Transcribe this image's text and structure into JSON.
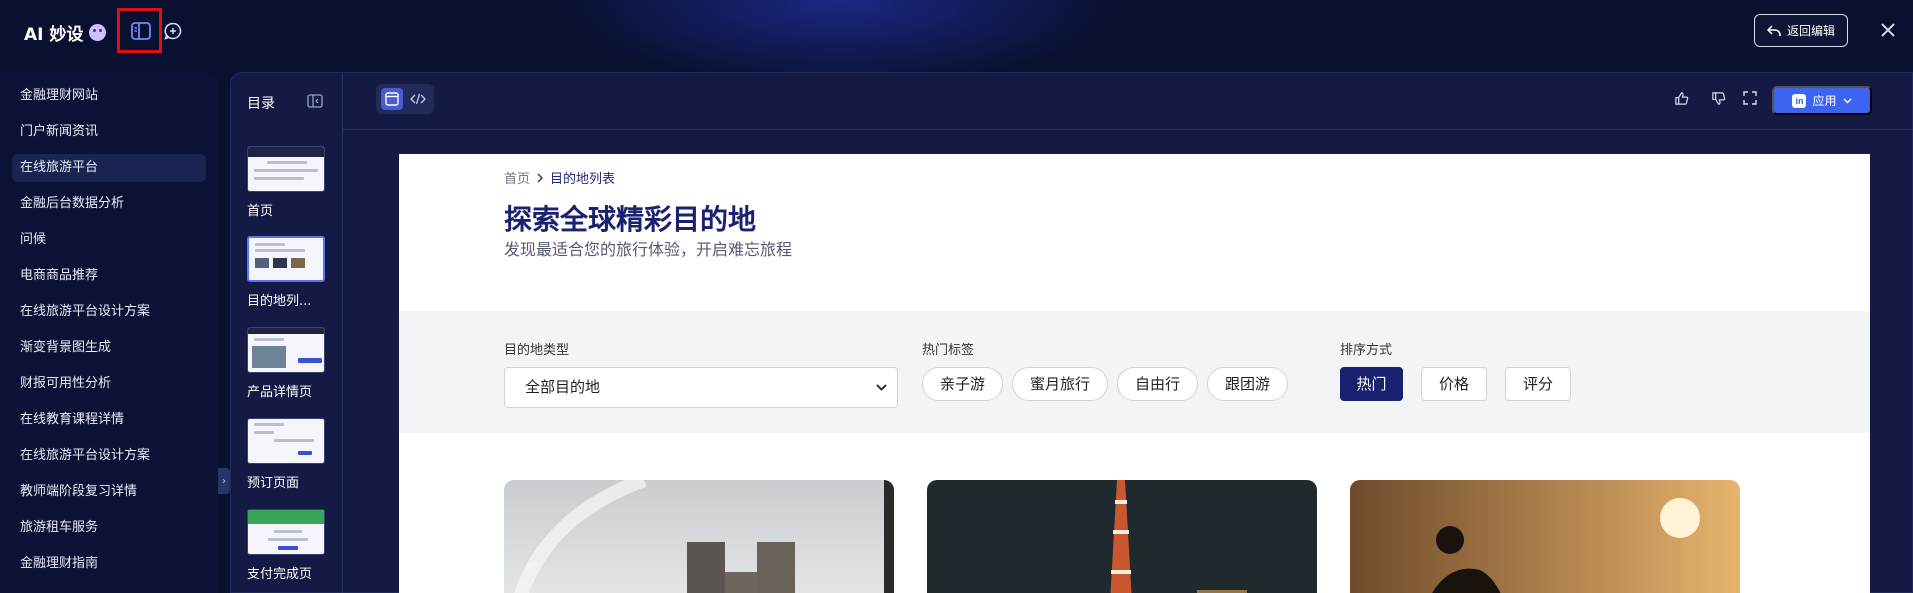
{
  "app": {
    "brand": "AI 妙设",
    "back_label": "返回编辑"
  },
  "sidebar": {
    "items": [
      {
        "label": "金融理财网站"
      },
      {
        "label": "门户新闻资讯"
      },
      {
        "label": "在线旅游平台"
      },
      {
        "label": "金融后台数据分析"
      },
      {
        "label": "问候"
      },
      {
        "label": "电商商品推荐"
      },
      {
        "label": "在线旅游平台设计方案"
      },
      {
        "label": "渐变背景图生成"
      },
      {
        "label": "财报可用性分析"
      },
      {
        "label": "在线教育课程详情"
      },
      {
        "label": "在线旅游平台设计方案"
      },
      {
        "label": "教师端阶段复习详情"
      },
      {
        "label": "旅游租车服务"
      },
      {
        "label": "金融理财指南"
      }
    ],
    "active_index": 2
  },
  "toc": {
    "title": "目录",
    "pages": [
      {
        "label": "首页"
      },
      {
        "label": "目的地列..."
      },
      {
        "label": "产品详情页"
      },
      {
        "label": "预订页面"
      },
      {
        "label": "支付完成页"
      }
    ]
  },
  "toolbar": {
    "apply_label": "应用"
  },
  "preview": {
    "breadcrumb_home": "首页",
    "breadcrumb_current": "目的地列表",
    "title": "探索全球精彩目的地",
    "subtitle": "发现最适合您的旅行体验，开启难忘旅程",
    "filter_type_label": "目的地类型",
    "filter_type_value": "全部目的地",
    "tags_label": "热门标签",
    "tags": [
      "亲子游",
      "蜜月旅行",
      "自由行",
      "跟团游"
    ],
    "sort_label": "排序方式",
    "sort_options": [
      "热门",
      "价格",
      "评分"
    ]
  },
  "colors": {
    "background": "#0a1030",
    "accent": "#3c64f0",
    "brand_navy": "#1a2170",
    "highlight": "#e01010"
  }
}
